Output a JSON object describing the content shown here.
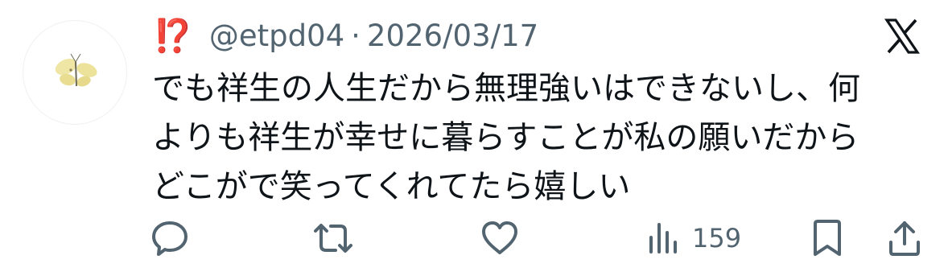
{
  "author": {
    "name_emoji": "⁉️",
    "handle": "@etpd04",
    "separator": "·",
    "date": "2026/03/17"
  },
  "tweet": {
    "lines": [
      "でも祥生の人生だから無理強いはできないし、何",
      "よりも祥生が幸せに暮らすことが私の願いだから",
      "どこがで笑ってくれてたら嬉しい"
    ]
  },
  "actions": {
    "reply_icon": "reply-icon",
    "retweet_icon": "retweet-icon",
    "like_icon": "like-icon",
    "views_icon": "views-icon",
    "views_count": "159",
    "bookmark_icon": "bookmark-icon",
    "share_icon": "share-icon"
  },
  "colors": {
    "text": "#0f1419",
    "secondary": "#536471",
    "accent_red": "#f4212e"
  }
}
